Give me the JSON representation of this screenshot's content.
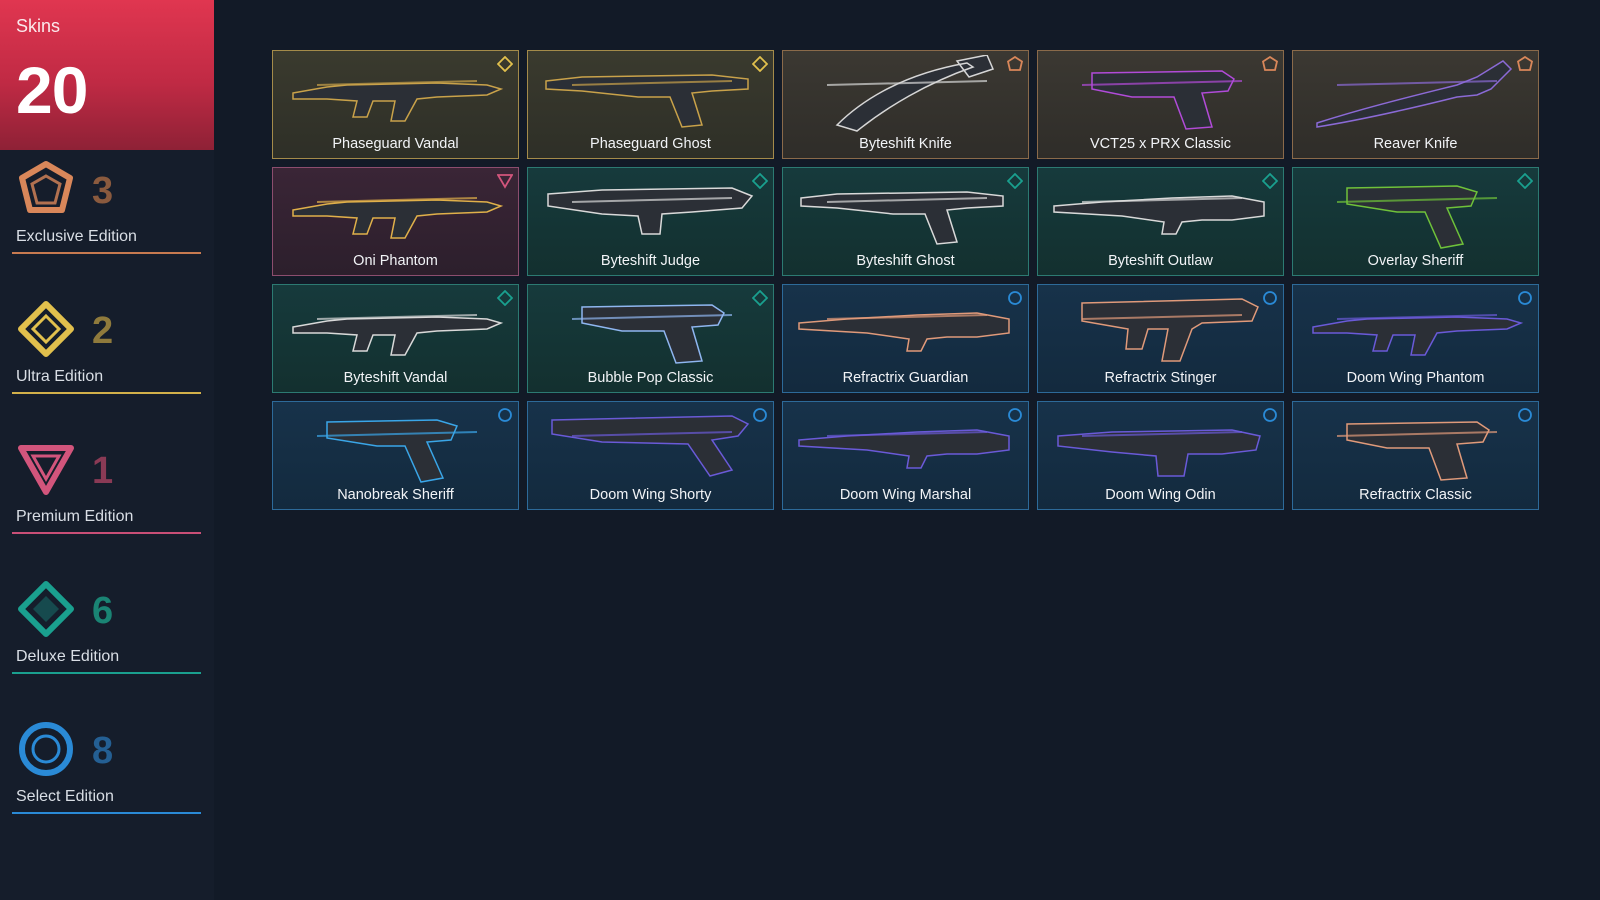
{
  "summary": {
    "label": "Skins",
    "count": "20"
  },
  "tiers": [
    {
      "id": "exclusive",
      "count": "3",
      "label": "Exclusive Edition",
      "color": "#d9875a",
      "icon": "exclusive-edition-icon"
    },
    {
      "id": "ultra",
      "count": "2",
      "label": "Ultra Edition",
      "color": "#e1c04d",
      "icon": "ultra-edition-icon"
    },
    {
      "id": "premium",
      "count": "1",
      "label": "Premium Edition",
      "color": "#d2557c",
      "icon": "premium-edition-icon"
    },
    {
      "id": "deluxe",
      "count": "6",
      "label": "Deluxe Edition",
      "color": "#1aa08f",
      "icon": "deluxe-edition-icon"
    },
    {
      "id": "select",
      "count": "8",
      "label": "Select Edition",
      "color": "#2a8ad6",
      "icon": "select-edition-icon"
    }
  ],
  "skins": [
    {
      "name": "Phaseguard Vandal",
      "tier": "ultra",
      "weapon": "rifle",
      "accent": "#c9a24a"
    },
    {
      "name": "Phaseguard Ghost",
      "tier": "ultra",
      "weapon": "pistol-long",
      "accent": "#c9a24a"
    },
    {
      "name": "Byteshift Knife",
      "tier": "exclusive",
      "weapon": "knife-curved",
      "accent": "#d6d6d6"
    },
    {
      "name": "VCT25 x PRX Classic",
      "tier": "exclusive",
      "weapon": "pistol",
      "accent": "#b14bd8"
    },
    {
      "name": "Reaver Knife",
      "tier": "exclusive",
      "weapon": "knife",
      "accent": "#8b6ad6"
    },
    {
      "name": "Oni Phantom",
      "tier": "premium",
      "weapon": "rifle",
      "accent": "#e0b04a"
    },
    {
      "name": "Byteshift Judge",
      "tier": "deluxe",
      "weapon": "shotgun",
      "accent": "#d9d9d9"
    },
    {
      "name": "Byteshift Ghost",
      "tier": "deluxe",
      "weapon": "pistol-long",
      "accent": "#d9d9d9"
    },
    {
      "name": "Byteshift Outlaw",
      "tier": "deluxe",
      "weapon": "sniper",
      "accent": "#d9d9d9"
    },
    {
      "name": "Overlay Sheriff",
      "tier": "deluxe",
      "weapon": "revolver",
      "accent": "#6fc23a"
    },
    {
      "name": "Byteshift Vandal",
      "tier": "deluxe",
      "weapon": "rifle",
      "accent": "#d9d9d9"
    },
    {
      "name": "Bubble Pop Classic",
      "tier": "deluxe",
      "weapon": "pistol",
      "accent": "#8fb6f0"
    },
    {
      "name": "Refractrix Guardian",
      "tier": "select",
      "weapon": "sniper",
      "accent": "#e09a7a"
    },
    {
      "name": "Refractrix Stinger",
      "tier": "select",
      "weapon": "smg",
      "accent": "#e09a7a"
    },
    {
      "name": "Doom Wing Phantom",
      "tier": "select",
      "weapon": "rifle",
      "accent": "#6a5ad8"
    },
    {
      "name": "Nanobreak Sheriff",
      "tier": "select",
      "weapon": "revolver",
      "accent": "#3aa6e8"
    },
    {
      "name": "Doom Wing Shorty",
      "tier": "select",
      "weapon": "shotgun-short",
      "accent": "#6a5ad8"
    },
    {
      "name": "Doom Wing Marshal",
      "tier": "select",
      "weapon": "sniper",
      "accent": "#6a5ad8"
    },
    {
      "name": "Doom Wing Odin",
      "tier": "select",
      "weapon": "lmg",
      "accent": "#6a5ad8"
    },
    {
      "name": "Refractrix Classic",
      "tier": "select",
      "weapon": "pistol",
      "accent": "#e09a7a"
    }
  ]
}
